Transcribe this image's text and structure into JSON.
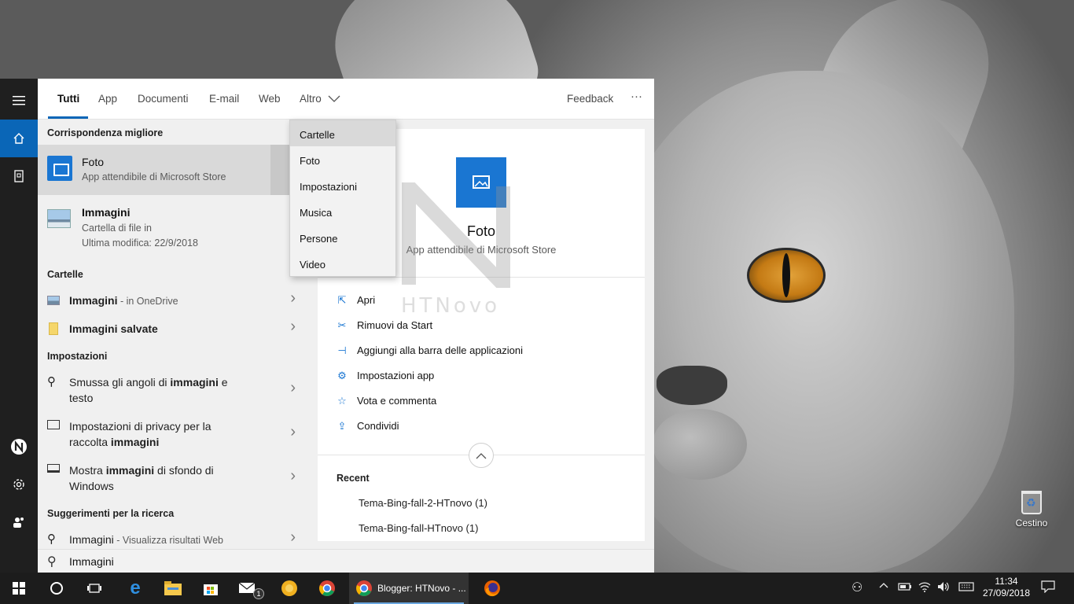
{
  "tabs": [
    {
      "label": "Tutti"
    },
    {
      "label": "App"
    },
    {
      "label": "Documenti"
    },
    {
      "label": "E-mail"
    },
    {
      "label": "Web"
    },
    {
      "label": "Altro"
    }
  ],
  "feedback_label": "Feedback",
  "more_label": "···",
  "dropdown": [
    "Cartelle",
    "Foto",
    "Impostazioni",
    "Musica",
    "Persone",
    "Video"
  ],
  "best_match": {
    "heading": "Corrispondenza migliore",
    "foto": {
      "title": "Foto",
      "sub": "App attendibile di Microsoft Store"
    },
    "immagini": {
      "title": "Immagini",
      "sub1": "Cartella di file in",
      "sub2": "Ultima modifica: 22/9/2018"
    }
  },
  "folders": {
    "heading": "Cartelle",
    "items": [
      {
        "bold": "Immagini",
        "rest": " - in OneDrive"
      },
      {
        "bold": "Immagini salvate",
        "rest": ""
      }
    ]
  },
  "settings": {
    "heading": "Impostazioni",
    "items": [
      {
        "pre": "Smussa gli angoli di ",
        "bold": "immagini",
        "post": " e",
        "line2": "testo"
      },
      {
        "pre": "Impostazioni di privacy per la",
        "bold": "",
        "post": "",
        "line2_pre": "raccolta ",
        "line2_bold": "immagini"
      },
      {
        "pre": "Mostra ",
        "bold": "immagini",
        "post": " di sfondo di",
        "line2": "Windows"
      }
    ]
  },
  "suggestions": {
    "heading": "Suggerimenti per la ricerca",
    "item": {
      "bold": "Immagini",
      "rest": " - Visualizza risultati Web"
    }
  },
  "search_query": "Immagini",
  "detail": {
    "title": "Foto",
    "sub": "App attendibile di Microsoft Store",
    "actions": [
      {
        "icon": "open-icon",
        "label": "Apri"
      },
      {
        "icon": "unpin-icon",
        "label": "Rimuovi da Start"
      },
      {
        "icon": "pin-icon",
        "label": "Aggiungi alla barra delle applicazioni"
      },
      {
        "icon": "gear-icon",
        "label": "Impostazioni app"
      },
      {
        "icon": "star-icon",
        "label": "Vota e commenta"
      },
      {
        "icon": "share-icon",
        "label": "Condividi"
      }
    ],
    "recent_heading": "Recent",
    "recent": [
      "Tema-Bing-fall-2-HTnovo (1)",
      "Tema-Bing-fall-HTnovo (1)"
    ]
  },
  "watermark": "HTNovo",
  "desktop": {
    "recycle_bin": "Cestino"
  },
  "taskbar": {
    "active_window": "Blogger: HTNovo - ...",
    "time": "11:34",
    "date": "27/09/2018",
    "mail_badge": "1"
  },
  "colors": {
    "accent": "#0a66b7",
    "rail": "#1f1f1f",
    "taskbar": "#1c1c1c"
  }
}
